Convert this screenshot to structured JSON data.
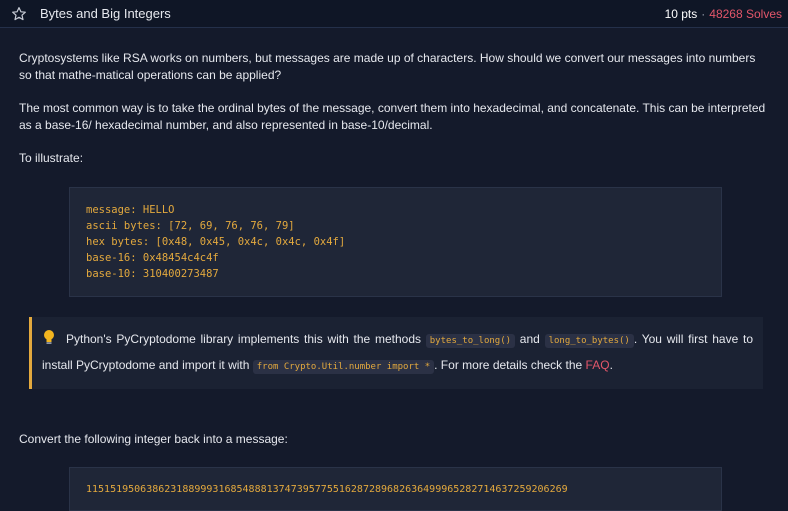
{
  "header": {
    "star_icon": "star-outline-icon",
    "title": "Bytes and Big Integers",
    "points": "10 pts",
    "separator": "·",
    "solves": "48268 Solves"
  },
  "content": {
    "p1": "Cryptosystems like RSA works on numbers, but messages are made up of characters. How should we convert our messages into numbers so that mathe-matical operations can be applied?",
    "p2": "The most common way is to take the ordinal bytes of the message, convert them into hexadecimal, and concatenate. This can be interpreted as a base-16/ hexadecimal number, and also represented in base-10/decimal.",
    "p3": "To illustrate:",
    "code_lines": [
      "message: HELLO",
      "ascii bytes: [72, 69, 76, 76, 79]",
      "hex bytes: [0x48, 0x45, 0x4c, 0x4c, 0x4f]",
      "base-16: 0x48454c4c4f",
      "base-10: 310400273487"
    ],
    "note": {
      "icon": "lightbulb-icon",
      "text_a": "Python's PyCryptodome library implements this with the methods ",
      "code_a": "bytes_to_long()",
      "text_b": " and ",
      "code_b": "long_to_bytes()",
      "text_c": ". You will first have to install PyCryptodome and import it with ",
      "code_c": "from Crypto.Util.number import *",
      "text_d": ". For more details check the ",
      "link": "FAQ",
      "text_e": "."
    },
    "p4": "Convert the following integer back into a message:",
    "integer": "11515195063862318899931685488813747395775516287289682636499965282714637259206269"
  },
  "colors": {
    "background": "#141a2b",
    "accent_orange": "#e3a93e",
    "solves_red": "#e2566a"
  }
}
